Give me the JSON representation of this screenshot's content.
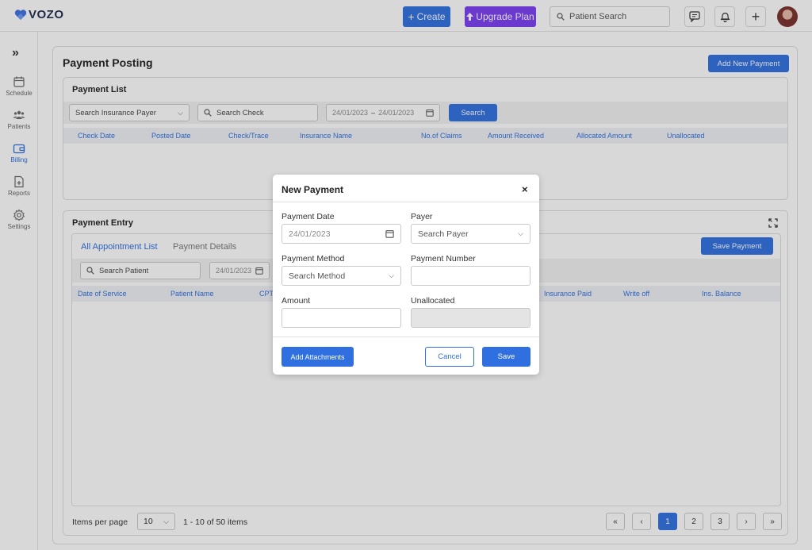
{
  "topbar": {
    "logo_text": "VOZO",
    "create_label": "Create",
    "upgrade_label": "Upgrade Plan",
    "patient_search_placeholder": "Patient Search"
  },
  "sidebar": {
    "items": [
      {
        "label": "Schedule",
        "icon": "calendar-icon"
      },
      {
        "label": "Patients",
        "icon": "users-icon"
      },
      {
        "label": "Billing",
        "icon": "wallet-icon",
        "active": true
      },
      {
        "label": "Reports",
        "icon": "report-icon"
      },
      {
        "label": "Settings",
        "icon": "gear-icon"
      }
    ]
  },
  "page": {
    "title": "Payment Posting",
    "add_new_payment_label": "Add New Payment"
  },
  "payment_list": {
    "title": "Payment List",
    "insurance_payer_placeholder": "Search Insurance Payer",
    "search_check_placeholder": "Search Check",
    "date_from": "24/01/2023",
    "date_to": "24/01/2023",
    "date_sep": "–",
    "search_label": "Search",
    "columns": [
      "Check Date",
      "Posted Date",
      "Check/Trace",
      "Insurance Name",
      "No.of Claims",
      "Amount Received",
      "Allocated Amount",
      "Unallocated"
    ]
  },
  "payment_entry": {
    "title": "Payment Entry",
    "tabs": [
      "All Appointment List",
      "Payment Details"
    ],
    "save_payment_label": "Save Payment",
    "search_patient_placeholder": "Search Patient",
    "date": "24/01/2023",
    "columns": [
      "Date of Service",
      "Patient Name",
      "CPT",
      "Insurance Paid",
      "Write off",
      "Ins. Balance"
    ],
    "items_per_page_label": "Items per page",
    "items_per_page": "10",
    "items_summary": "1 - 10 of 50 items",
    "pages": [
      "1",
      "2",
      "3"
    ],
    "first_label": "«",
    "prev_label": "‹",
    "next_label": "›",
    "last_label": "»"
  },
  "modal": {
    "title": "New Payment",
    "close_label": "×",
    "payment_date_label": "Payment Date",
    "payment_date_value": "24/01/2023",
    "payer_label": "Payer",
    "payer_placeholder": "Search Payer",
    "payment_method_label": "Payment Method",
    "payment_method_placeholder": "Search Method",
    "payment_number_label": "Payment Number",
    "amount_label": "Amount",
    "unallocated_label": "Unallocated",
    "add_attachments_label": "Add Attachments",
    "cancel_label": "Cancel",
    "save_label": "Save"
  },
  "colors": {
    "primary": "#2f6fe0",
    "upgrade": "#7b3df2",
    "header_text": "#2f6fe0"
  }
}
